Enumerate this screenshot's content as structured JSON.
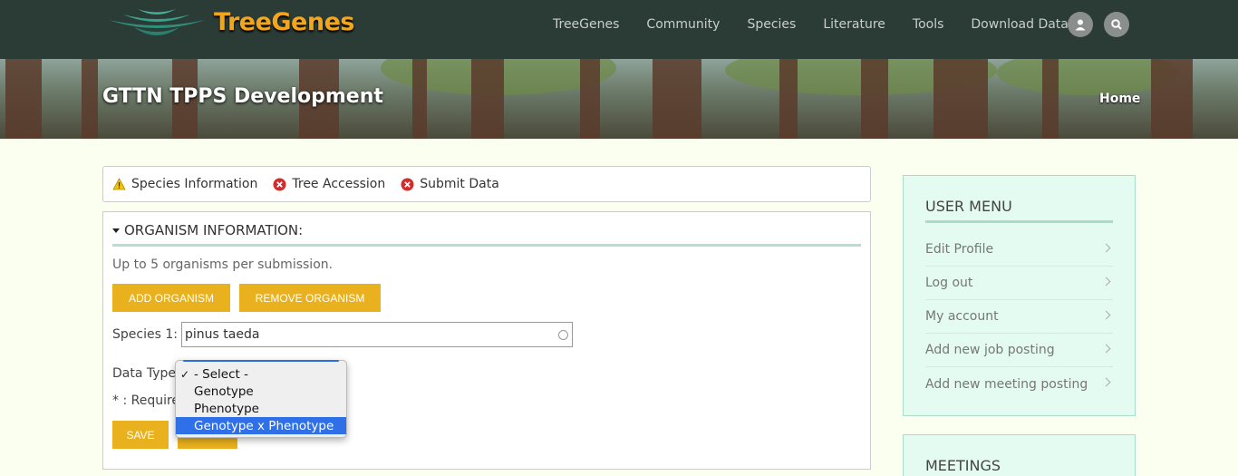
{
  "site": {
    "logo_text": "TreeGenes"
  },
  "nav": {
    "items": [
      "TreeGenes",
      "Community",
      "Species",
      "Literature",
      "Tools",
      "Download Data"
    ],
    "icons": [
      "user-icon",
      "search-icon"
    ]
  },
  "banner": {
    "title": "GTTN TPPS Development",
    "breadcrumb": "Home"
  },
  "progress": {
    "steps": [
      {
        "label": "Species Information",
        "status": "warning",
        "icon": "warning-icon"
      },
      {
        "label": "Tree Accession",
        "status": "error",
        "icon": "error-icon"
      },
      {
        "label": "Submit Data",
        "status": "error",
        "icon": "error-icon"
      }
    ]
  },
  "form": {
    "section_title": "ORGANISM INFORMATION:",
    "description": "Up to 5 organisms per submission.",
    "add_button": "ADD ORGANISM",
    "remove_button": "REMOVE ORGANISM",
    "species_label": "Species 1: *",
    "species_value": "pinus taeda",
    "data_type_label": "Data Type:",
    "required_note": "* : Required",
    "save_button": "SAVE",
    "data_type_options": [
      {
        "label": "- Select -",
        "checked": true,
        "highlighted": false
      },
      {
        "label": "Genotype",
        "checked": false,
        "highlighted": false
      },
      {
        "label": "Phenotype",
        "checked": false,
        "highlighted": false
      },
      {
        "label": "Genotype x Phenotype",
        "checked": false,
        "highlighted": true
      }
    ]
  },
  "sidebar": {
    "user_menu": {
      "title": "USER MENU",
      "items": [
        "Edit Profile",
        "Log out",
        "My account",
        "Add new job posting",
        "Add new meeting posting"
      ]
    },
    "meetings": {
      "title": "MEETINGS"
    }
  },
  "colors": {
    "accent": "#e9b11d",
    "nav_bg": "#2b3b36",
    "logo": "#f3a51c",
    "sidebar_bg": "#e3fbf1",
    "highlight": "#2f6fe8"
  }
}
